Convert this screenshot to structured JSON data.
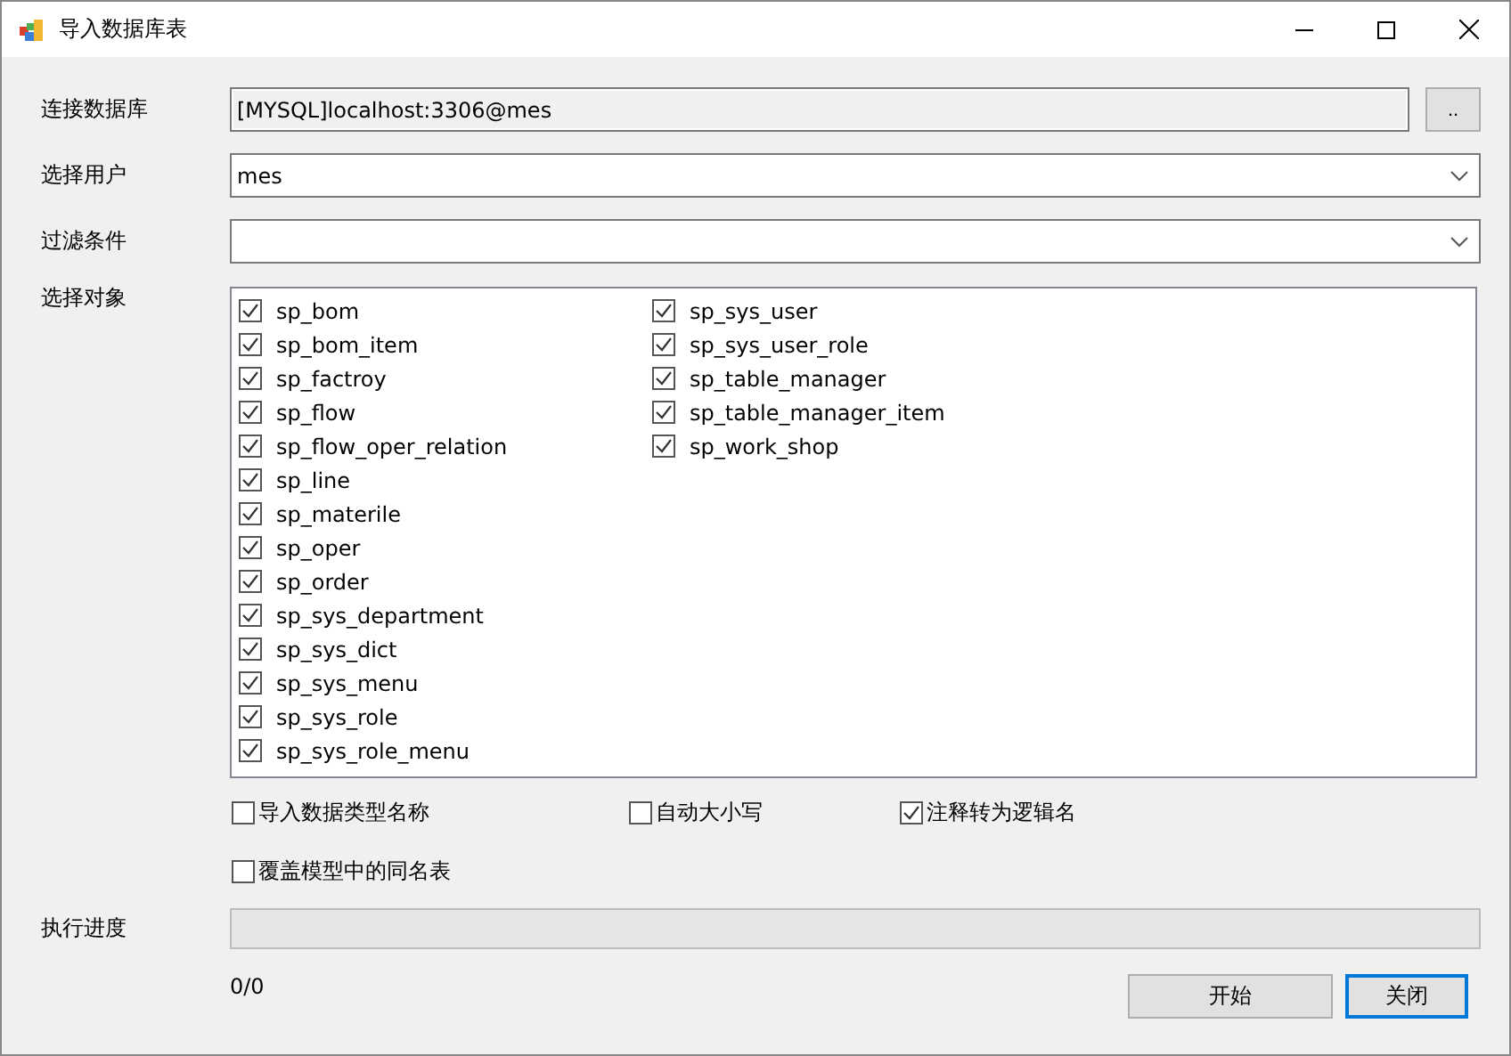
{
  "window": {
    "title": "导入数据库表"
  },
  "fields": [
    {
      "label": "连接数据库",
      "kind": "readonly",
      "value": "[MYSQL]localhost:3306@mes",
      "button": ".."
    },
    {
      "label": "选择用户",
      "kind": "dropdown",
      "value": "mes"
    },
    {
      "label": "过滤条件",
      "kind": "dropdown"
    }
  ],
  "objects": {
    "label": "选择对象",
    "columns": [
      [
        {
          "name": "sp_bom",
          "checked": true
        },
        {
          "name": "sp_bom_item",
          "checked": true
        },
        {
          "name": "sp_factroy",
          "checked": true
        },
        {
          "name": "sp_flow",
          "checked": true
        },
        {
          "name": "sp_flow_oper_relation",
          "checked": true
        },
        {
          "name": "sp_line",
          "checked": true
        },
        {
          "name": "sp_materile",
          "checked": true
        },
        {
          "name": "sp_oper",
          "checked": true
        },
        {
          "name": "sp_order",
          "checked": true
        },
        {
          "name": "sp_sys_department",
          "checked": true
        },
        {
          "name": "sp_sys_dict",
          "checked": true
        },
        {
          "name": "sp_sys_menu",
          "checked": true
        },
        {
          "name": "sp_sys_role",
          "checked": true
        },
        {
          "name": "sp_sys_role_menu",
          "checked": true
        }
      ],
      [
        {
          "name": "sp_sys_user",
          "checked": true
        },
        {
          "name": "sp_sys_user_role",
          "checked": true
        },
        {
          "name": "sp_table_manager",
          "checked": true
        },
        {
          "name": "sp_table_manager_item",
          "checked": true
        },
        {
          "name": "sp_work_shop",
          "checked": true
        }
      ]
    ]
  },
  "options": [
    {
      "label": "导入数据类型名称",
      "checked": false
    },
    {
      "label": "自动大小写",
      "checked": false
    },
    {
      "label": "注释转为逻辑名",
      "checked": true
    },
    {
      "label": "覆盖模型中的同名表",
      "checked": false
    }
  ],
  "progress": {
    "label": "执行进度",
    "level": 0,
    "count": "0/0"
  },
  "buttons": [
    {
      "label": "开始",
      "focused": false
    },
    {
      "label": "关闭",
      "focused": true
    }
  ]
}
